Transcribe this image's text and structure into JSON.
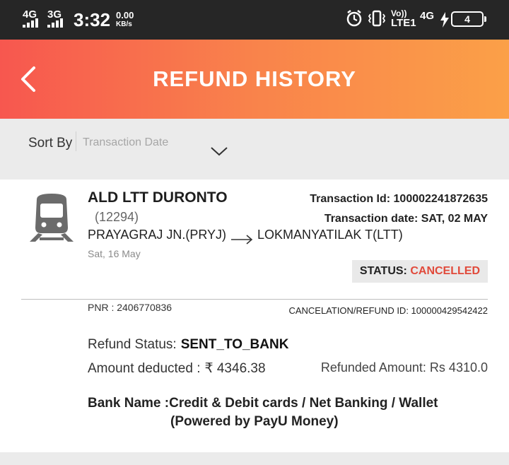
{
  "status_bar": {
    "net1": "4G",
    "net2": "3G",
    "time": "3:32",
    "speed_value": "0.00",
    "speed_unit": "KB/s",
    "volte_top": "Vo))",
    "volte_bottom": "LTE1",
    "net3": "4G",
    "battery_level": "4",
    "icons": [
      "alarm-icon",
      "vibrate-icon",
      "charging-icon"
    ]
  },
  "header": {
    "title": "REFUND HISTORY",
    "back_icon": "chevron-left-icon"
  },
  "sort": {
    "label": "Sort By",
    "selected": "Transaction Date"
  },
  "booking": {
    "train_name": "ALD LTT DURONTO",
    "train_number": "(12294)",
    "from": "PRAYAGRAJ JN.(PRYJ)",
    "to": "LOKMANYATILAK T(LTT)",
    "journey_date": "Sat, 16 May",
    "transaction_id": "Transaction Id: 100002241872635",
    "transaction_date": "Transaction date: SAT, 02 MAY",
    "status_label": "STATUS:",
    "status_value": "CANCELLED",
    "pnr": "PNR : 2406770836",
    "refund_id": "CANCELATION/REFUND ID: 100000429542422",
    "refund_status_label": "Refund Status:",
    "refund_status_value": "SENT_TO_BANK",
    "amount_deducted_label": "Amount deducted :",
    "amount_deducted_value": "₹ 4346.38",
    "refunded_amount": "Refunded Amount: Rs 4310.0",
    "bank_line1": "Bank Name :Credit & Debit cards / Net Banking / Wallet",
    "bank_line2": "(Powered by PayU Money)"
  },
  "colors": {
    "header_start": "#f7574f",
    "header_end": "#fba048",
    "status_cancelled": "#e14a3b"
  }
}
